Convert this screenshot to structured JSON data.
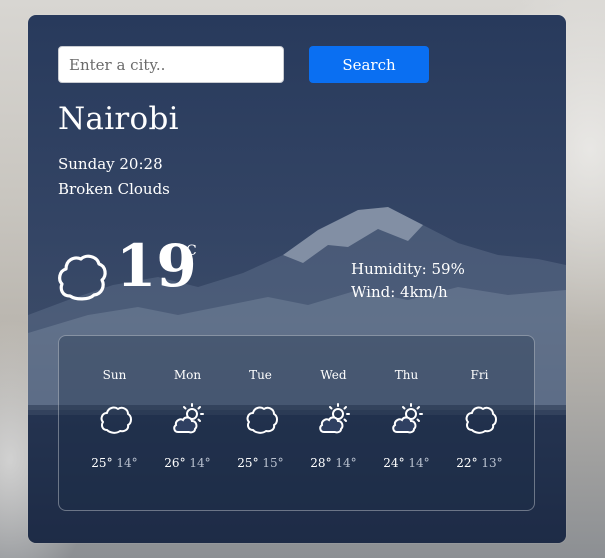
{
  "search": {
    "placeholder": "Enter a city..",
    "button_label": "Search"
  },
  "current": {
    "city": "Nairobi",
    "datetime": "Sunday 20:28",
    "condition": "Broken Clouds",
    "temperature": "19",
    "unit": "°C",
    "humidity": "Humidity: 59%",
    "wind": "Wind: 4km/h",
    "icon": "cloud-icon"
  },
  "forecast": [
    {
      "day": "Sun",
      "high": "25°",
      "low": "14°",
      "icon": "cloud-icon"
    },
    {
      "day": "Mon",
      "high": "26°",
      "low": "14°",
      "icon": "sun-cloud-icon"
    },
    {
      "day": "Tue",
      "high": "25°",
      "low": "15°",
      "icon": "cloud-icon"
    },
    {
      "day": "Wed",
      "high": "28°",
      "low": "14°",
      "icon": "sun-cloud-icon"
    },
    {
      "day": "Thu",
      "high": "24°",
      "low": "14°",
      "icon": "sun-cloud-icon"
    },
    {
      "day": "Fri",
      "high": "22°",
      "low": "13°",
      "icon": "cloud-icon"
    }
  ],
  "colors": {
    "accent": "#0a6ff2",
    "card": "#2f4062",
    "text": "#ffffff"
  }
}
